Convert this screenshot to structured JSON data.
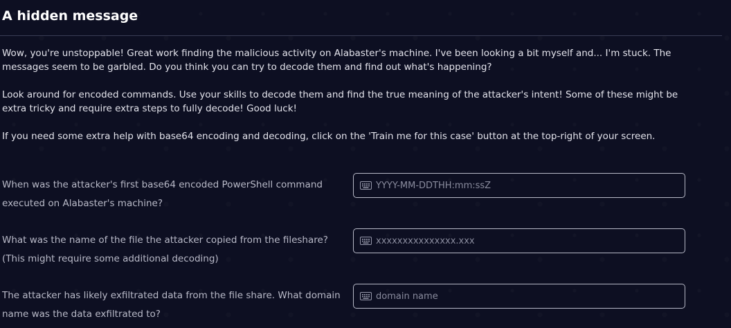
{
  "page": {
    "title": "A hidden message"
  },
  "intro": {
    "paragraph_1": "Wow, you're unstoppable! Great work finding the malicious activity on Alabaster's machine. I've been looking a bit myself and... I'm stuck. The messages seem to be garbled. Do you think you can try to decode them and find out what's happening?",
    "paragraph_2": "Look around for encoded commands. Use your skills to decode them and find the true meaning of the attacker's intent! Some of these might be extra tricky and require extra steps to fully decode! Good luck!",
    "paragraph_3": "If you need some extra help with base64 encoding and decoding, click on the 'Train me for this case' button at the top-right of your screen."
  },
  "questions": [
    {
      "label": "When was the attacker's first base64 encoded PowerShell command executed on Alabaster's machine?",
      "placeholder": "YYYY-MM-DDTHH:mm:ssZ",
      "value": ""
    },
    {
      "label": "What was the name of the file the attacker copied from the fileshare? (This might require some additional decoding)",
      "placeholder": "xxxxxxxxxxxxxxx.xxx",
      "value": ""
    },
    {
      "label": "The attacker has likely exfiltrated data from the file share. What domain name was the data exfiltrated to?",
      "placeholder": "domain name",
      "value": ""
    }
  ],
  "icons": {
    "input_prefix": "keyboard-icon"
  },
  "colors": {
    "background": "#0d0f22",
    "text": "#e4e4ec",
    "label": "#b9bac8",
    "border": "#b8bac8",
    "placeholder": "#8a8c9e"
  }
}
